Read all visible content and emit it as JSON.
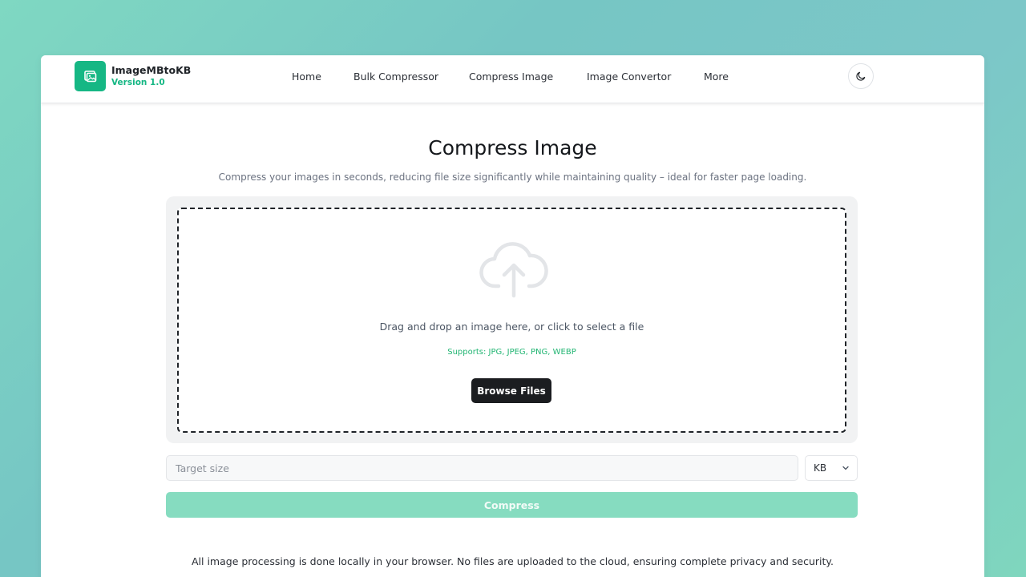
{
  "header": {
    "brand_name": "ImageMBtoKB",
    "brand_version": "Version 1.0",
    "nav": [
      {
        "label": "Home"
      },
      {
        "label": "Bulk Compressor"
      },
      {
        "label": "Compress Image"
      },
      {
        "label": "Image Convertor"
      },
      {
        "label": "More"
      }
    ],
    "theme_icon": "moon-icon"
  },
  "main": {
    "title": "Compress Image",
    "subtitle": "Compress your images in seconds, reducing file size significantly while maintaining quality – ideal for faster page loading.",
    "dropzone": {
      "icon": "cloud-upload-icon",
      "text": "Drag and drop an image here, or click to select a file",
      "supports": "Supports: JPG, JPEG, PNG, WEBP",
      "browse_label": "Browse Files"
    },
    "target_size": {
      "value": "",
      "placeholder": "Target size"
    },
    "unit": {
      "selected": "KB",
      "options": [
        "KB"
      ]
    },
    "compress_label": "Compress",
    "privacy_note": "All image processing is done locally in your browser. No files are uploaded to the cloud, ensuring complete privacy and security."
  },
  "colors": {
    "accent": "#16b784",
    "compress_disabled": "#86dcc0",
    "dark_button": "#1b1d20",
    "supports_text": "#22b573"
  }
}
